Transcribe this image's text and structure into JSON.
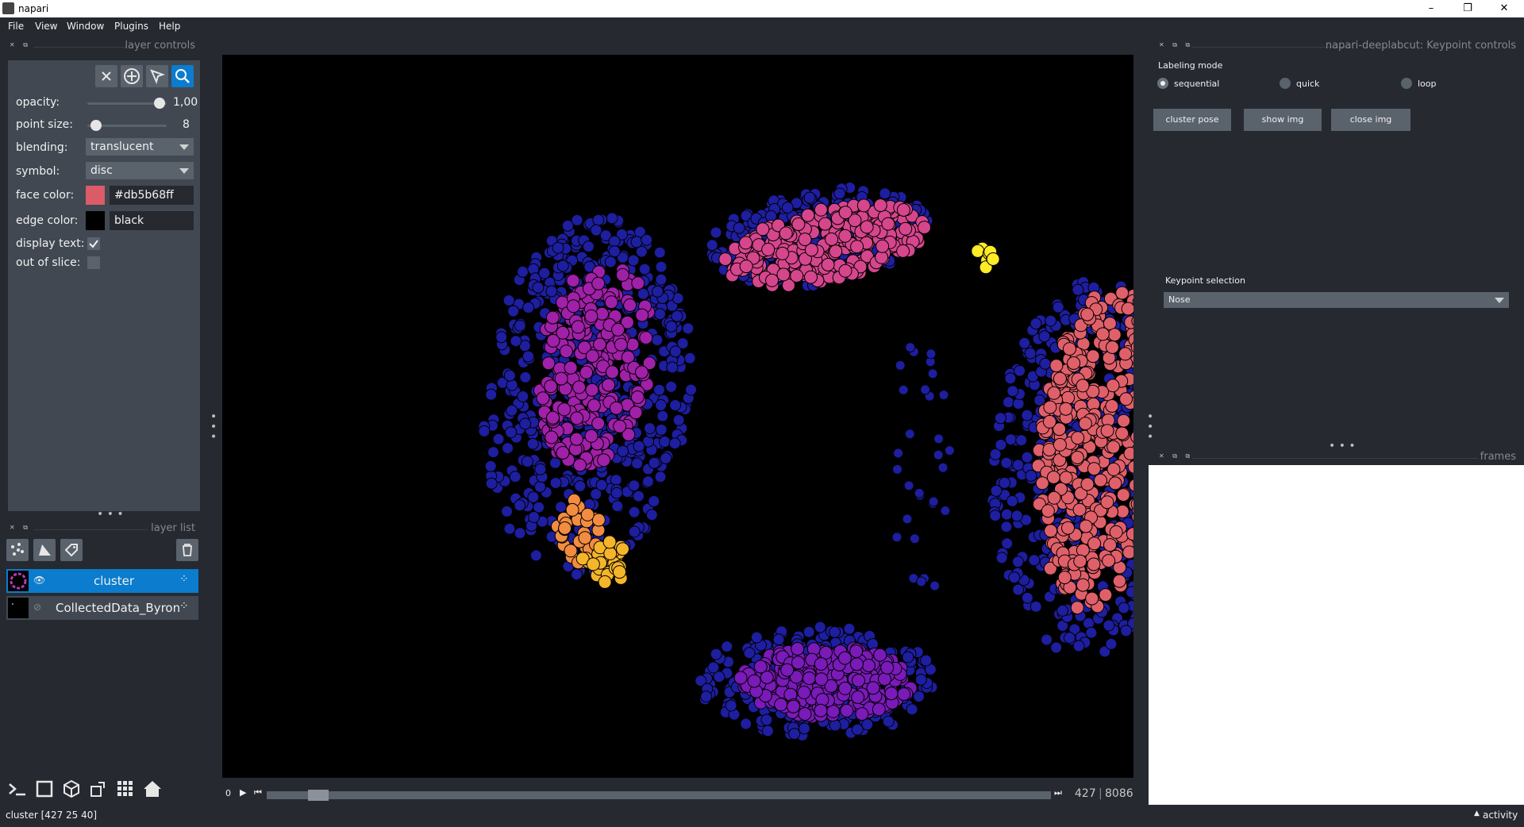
{
  "window": {
    "title": "napari",
    "minimize": "–",
    "restore": "❐",
    "close": "✕"
  },
  "menu": [
    "File",
    "View",
    "Window",
    "Plugins",
    "Help"
  ],
  "layer_controls": {
    "header": "layer controls",
    "opacity_label": "opacity:",
    "opacity_value": "1,00",
    "opacity": 1.0,
    "point_size_label": "point size:",
    "point_size_value": "8",
    "blending_label": "blending:",
    "blending_value": "translucent",
    "symbol_label": "symbol:",
    "symbol_value": "disc",
    "face_color_label": "face color:",
    "face_color_value": "#db5b68ff",
    "face_color": "#db5b68",
    "edge_color_label": "edge color:",
    "edge_color_value": "black",
    "edge_color": "#000000",
    "display_text_label": "display text:",
    "display_text_checked": true,
    "out_of_slice_label": "out of slice:",
    "out_of_slice_checked": false
  },
  "layer_list": {
    "header": "layer list",
    "layers": [
      {
        "name": "cluster",
        "visible": true,
        "selected": true
      },
      {
        "name": "CollectedData_Byron",
        "visible": false,
        "selected": false
      }
    ]
  },
  "dims": {
    "start": "0",
    "current": "427",
    "total": "8086",
    "fraction": 0.053
  },
  "status": {
    "text": "cluster [427  25  40]",
    "activity": "activity"
  },
  "keypoint_controls": {
    "header": "napari-deeplabcut: Keypoint controls",
    "labeling_mode": "Labeling mode",
    "modes": [
      "sequential",
      "quick",
      "loop"
    ],
    "selected_mode": "sequential",
    "buttons": [
      "cluster pose",
      "show img",
      "close img"
    ],
    "keypoint_selection_label": "Keypoint selection",
    "keypoint_selection_value": "Nose"
  },
  "frames": {
    "header": "frames"
  },
  "colors": {
    "accent": "#0b7cce",
    "background": "#262930",
    "panel": "#414851",
    "point_blue": "#1e1ea0",
    "point_pink": "#d6468c",
    "point_magenta": "#a020a8",
    "point_salmon": "#e0606a",
    "point_orange": "#f28c40",
    "point_gold": "#f5b52a",
    "point_yellow": "#ffeb26",
    "point_purple": "#7a1ab8"
  }
}
